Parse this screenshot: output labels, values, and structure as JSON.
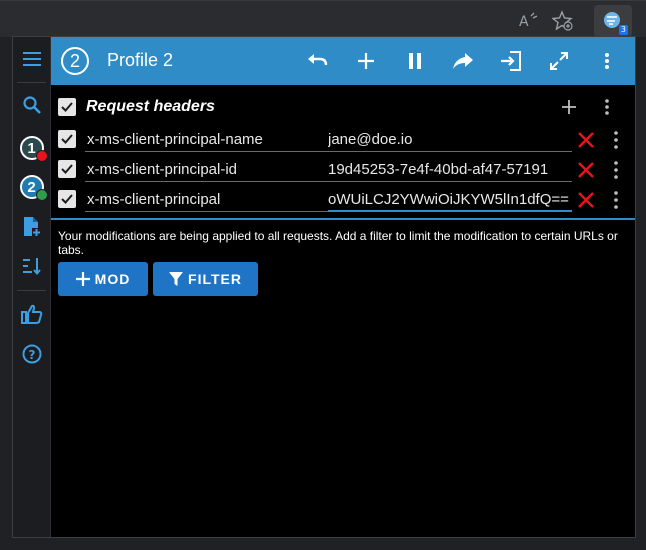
{
  "browser": {
    "ext_badge": "3"
  },
  "header": {
    "profile_number": "2",
    "title": "Profile 2"
  },
  "sidebar": {
    "profiles": [
      {
        "number": "1",
        "status": "red"
      },
      {
        "number": "2",
        "status": "green"
      }
    ]
  },
  "section": {
    "title": "Request headers"
  },
  "rows": [
    {
      "name": "x-ms-client-principal-name",
      "value": "jane@doe.io",
      "enabled": true
    },
    {
      "name": "x-ms-client-principal-id",
      "value": "19d45253-7e4f-40bd-af47-57191",
      "enabled": true
    },
    {
      "name": "x-ms-client-principal",
      "value": "oWUiLCJ2YWwiOiJKYW5lIn1dfQ==",
      "enabled": true
    }
  ],
  "info_text": "Your modifications are being applied to all requests. Add a filter to limit the modification to certain URLs or tabs.",
  "buttons": {
    "mod": "MOD",
    "filter": "FILTER"
  },
  "colors": {
    "accent": "#2f8cc6",
    "button": "#1f74c6",
    "delete": "#e8131d"
  }
}
